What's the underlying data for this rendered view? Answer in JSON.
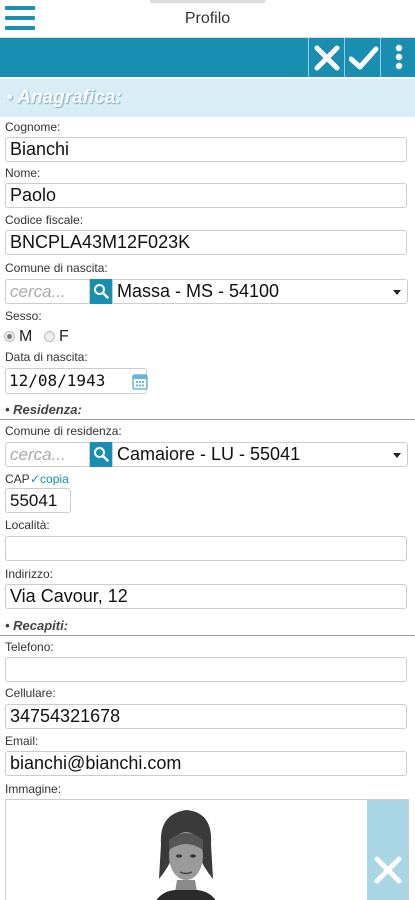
{
  "header": {
    "title": "Profilo"
  },
  "sections": {
    "anagrafica": "• Anagrafica:",
    "residenza": "• Residenza:",
    "recapiti": "• Recapiti:"
  },
  "fields": {
    "cognome": {
      "label": "Cognome:",
      "value": "Bianchi"
    },
    "nome": {
      "label": "Nome:",
      "value": "Paolo"
    },
    "codice_fiscale": {
      "label": "Codice fiscale:",
      "value": "BNCPLA43M12F023K"
    },
    "comune_nascita": {
      "label": "Comune di nascita:",
      "search_placeholder": "cerca...",
      "selected": "Massa - MS - 54100"
    },
    "sesso": {
      "label": "Sesso:",
      "options": [
        "M",
        "F"
      ],
      "selected": "M"
    },
    "data_nascita": {
      "label": "Data di nascita:",
      "value": "12/08/1943"
    },
    "comune_residenza": {
      "label": "Comune di residenza:",
      "search_placeholder": "cerca...",
      "selected": "Camaiore - LU - 55041"
    },
    "cap": {
      "label": "CAP",
      "copy_label": "✓copia",
      "value": "55041"
    },
    "localita": {
      "label": "Località:",
      "value": ""
    },
    "indirizzo": {
      "label": "Indirizzo:",
      "value": "Via Cavour, 12"
    },
    "telefono": {
      "label": "Telefono:",
      "value": ""
    },
    "cellulare": {
      "label": "Cellulare:",
      "value": "34754321678"
    },
    "email": {
      "label": "Email:",
      "value": "bianchi@bianchi.com"
    },
    "immagine": {
      "label": "Immagine:"
    }
  },
  "icons": {
    "menu": "menu-icon",
    "close": "close-icon",
    "save": "check-icon",
    "more": "more-vertical-icon",
    "search": "search-icon",
    "calendar": "calendar-icon",
    "delete_image": "delete-image-icon"
  },
  "colors": {
    "accent": "#1a8eb0",
    "section_bg": "#d8eef6",
    "image_delete_bg": "#a9d6e5"
  }
}
